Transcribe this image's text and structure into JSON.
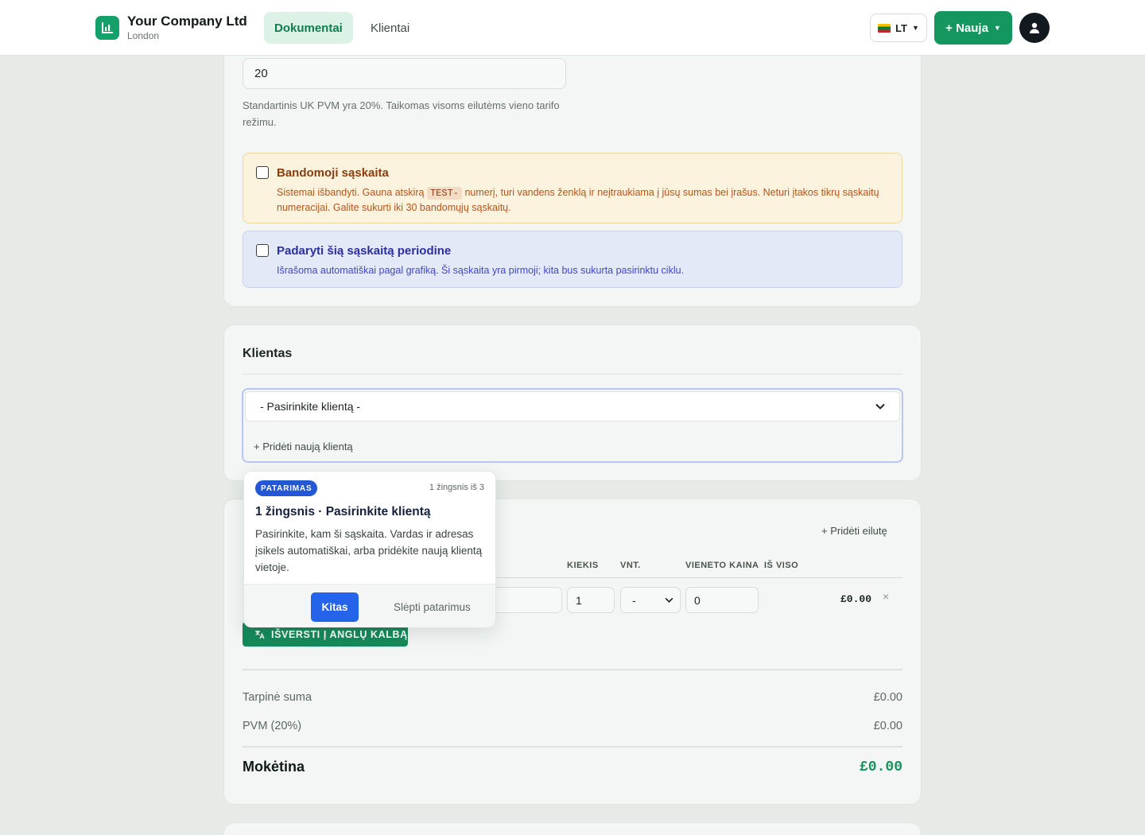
{
  "header": {
    "company_name": "Your Company Ltd",
    "company_city": "London",
    "nav": [
      {
        "label": "Dokumentai",
        "active": true
      },
      {
        "label": "Klientai",
        "active": false
      }
    ],
    "language": "LT",
    "new_button": "+ Nauja"
  },
  "tax": {
    "vat_rate_value": "20",
    "help_text": "Standartinis UK PVM yra 20%. Taikomas visoms eilutėms vieno tarifo režimu."
  },
  "test_invoice": {
    "title": "Bandomoji sąskaita",
    "text_before": "Sistemai išbandyti. Gauna atskirą ",
    "code": "TEST-",
    "text_after": " numerį, turi vandens ženklą ir neįtraukiama į jūsų sumas bei įrašus. Neturi įtakos tikrų sąskaitų numeracijai. Galite sukurti iki 30 bandomųjų sąskaitų."
  },
  "recurring": {
    "title": "Padaryti šią sąskaitą periodine",
    "text": "Išrašoma automatiškai pagal grafiką. Ši sąskaita yra pirmoji; kita bus sukurta pasirinktu ciklu."
  },
  "client": {
    "section_title": "Klientas",
    "select_placeholder": "- Pasirinkite klientą -",
    "add_new": "+ Pridėti naują klientą"
  },
  "items": {
    "add_line": "+ Pridėti eilutę",
    "columns": {
      "quantity": "KIEKIS",
      "unit": "VNT.",
      "unit_price": "VIENETO KAINA",
      "total": "IŠ VISO"
    },
    "row": {
      "quantity": "1",
      "unit": "-",
      "unit_price": "0",
      "total": "£0.00"
    },
    "remove": "×",
    "translate_button": "IŠVERSTI Į ANGLŲ KALBĄ"
  },
  "totals": {
    "subtotal_label": "Tarpinė suma",
    "subtotal_value": "£0.00",
    "vat_label": "PVM (20%)",
    "vat_value": "£0.00",
    "payable_label": "Mokėtina",
    "payable_value": "£0.00"
  },
  "tooltip": {
    "badge": "PATARIMAS",
    "step": "1 žingsnis iš 3",
    "title": "1 žingsnis · Pasirinkite klientą",
    "body": "Pasirinkite, kam ši sąskaita. Vardas ir adresas įsikels automatiškai, arba pridėkite naują klientą vietoje.",
    "next": "Kitas",
    "hide": "Slėpti patarimus"
  },
  "colors": {
    "brand": "#13975f",
    "tip_accent": "#2563eb",
    "warning_bg": "#fbf3de",
    "info_bg": "#e4e9f7"
  }
}
